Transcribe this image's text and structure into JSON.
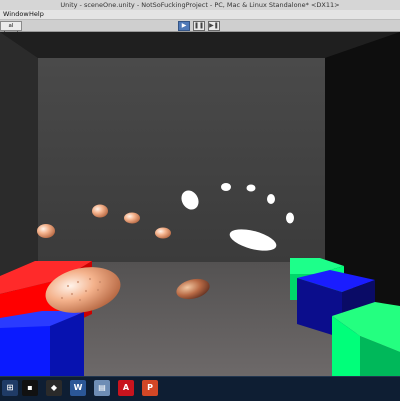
{
  "window": {
    "title": "Unity - sceneOne.unity - NotSoFuckingProject - PC, Mac & Linux Standalone* <DX11>"
  },
  "menubar": {
    "items": [
      "Window",
      "Help"
    ]
  },
  "toolbar": {
    "pivot_label": "al Local",
    "play_icons": [
      "play-icon",
      "pause-icon",
      "step-icon"
    ],
    "play_active_color": "#4f79b8"
  },
  "scene": {
    "background_color": "#000000",
    "room_back_wall_color": "#444444",
    "floor_color": "#5e5b5b",
    "cube_colors": {
      "red": "#ff0000",
      "blue": "#0a1aff",
      "green": "#00ff7a",
      "navy": "#0b0d8c"
    },
    "sphere_colors": {
      "peach": "#f4b28c",
      "white": "#ffffff",
      "bronze": "#b86a45"
    }
  },
  "taskbar": {
    "icons": [
      "network-icon",
      "terminal-icon",
      "unity-icon",
      "word-icon",
      "file-icon",
      "acrobat-icon",
      "powerpoint-icon"
    ]
  }
}
